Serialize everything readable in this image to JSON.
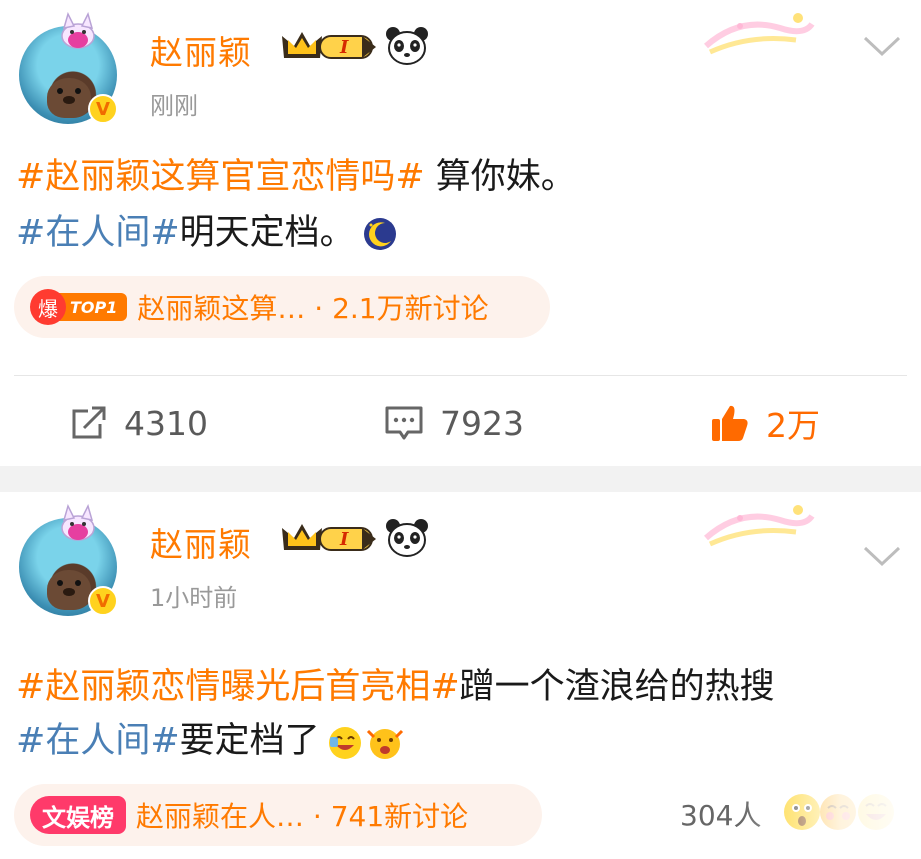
{
  "posts": [
    {
      "username": "赵丽颖",
      "vip_level": "I",
      "time": "刚刚",
      "line1_tag": "#赵丽颖这算官宣恋情吗#",
      "line1_text": " 算你妹。",
      "line2_tag": "#在人间#",
      "line2_text": "明天定档。",
      "line2_emoji": "moon-icon",
      "hot_badge": "爆",
      "hot_rank": "TOP1",
      "hot_topic": "赵丽颖这算… · 2.1万新讨论",
      "repost_count": "4310",
      "comment_count": "7923",
      "like_count": "2万"
    },
    {
      "username": "赵丽颖",
      "vip_level": "I",
      "time": "1小时前",
      "line1_tag": "#赵丽颖恋情曝光后首亮相#",
      "line1_text": "蹭一个渣浪给的热搜",
      "line2_tag": "#在人间#",
      "line2_text": "要定档了",
      "hot_badge": "文娱榜",
      "hot_topic": "赵丽颖在人… · 741新讨论",
      "reactions_count": "304人"
    }
  ],
  "colors": {
    "accent_orange": "#ff7a00",
    "topic_blue": "#4a7fb5",
    "time_gray": "#999999",
    "pill_bg": "#fdf2ec",
    "ent_tag_red": "#ff3a6a"
  }
}
